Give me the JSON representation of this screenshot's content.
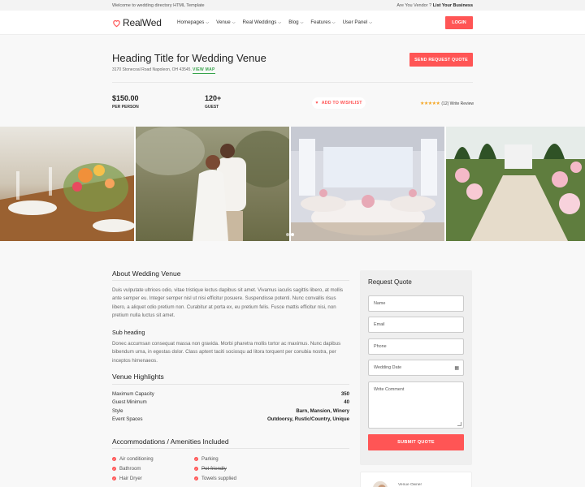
{
  "topbar": {
    "welcome": "Welcome to wedding directory HTML Template",
    "vendor_question": "Are You Vendor ?",
    "list_business": "List Your Business"
  },
  "nav": {
    "logo": "RealWed",
    "menu": [
      "Homepages",
      "Venue",
      "Real Weddings",
      "Blog",
      "Features",
      "User Panel"
    ],
    "login": "LOGIN"
  },
  "venue": {
    "title": "Heading Title for Wedding Venue",
    "address": "3170 Stonecoal Road Napoleon, OH 43545.",
    "view_map": "VIEW MAP",
    "request_quote": "SEND REQUEST QUOTE",
    "price": "$150.00",
    "price_label": "PER PERSON",
    "guests": "120+",
    "guests_label": "GUEST",
    "wishlist": "ADD TO WISHLIST",
    "reviews": "(12) Write Review",
    "rating_stars": 5
  },
  "gallery": {
    "active_slide": 1,
    "slide_count": 2
  },
  "about": {
    "title": "About Wedding Venue",
    "paragraph": "Duis vulputate ultrices odio, vitae tristique lectus dapibus sit amet. Vivamus iaculis sagittis libero, at mollis ante semper eu. Integer semper nisl ut nisi efficitur posuere. Suspendisse potenti. Nunc convallis risus libero, a aliquet odio pretium non. Curabitur at porta ex, eu pretium felis. Fusce mattis efficitur nisi, non pretium nulla luctus sit amet.",
    "subheading": "Sub heading",
    "sub_paragraph": "Donec accumsan consequat massa non gravida. Morbi pharetra mollis tortor ac maximus. Nunc dapibus bibendum urna, in egestas dolor. Class aptent taciti sociosqu ad litora torquent per conubia nostra, per inceptos himenaeos."
  },
  "highlights": {
    "title": "Venue Highlights",
    "rows": [
      {
        "label": "Maximum Capacity",
        "value": "350"
      },
      {
        "label": "Guest Minimum",
        "value": "40"
      },
      {
        "label": "Style",
        "value": "Barn, Mansion, Winery"
      },
      {
        "label": "Event Spaces",
        "value": "Outdoorsy, Rustic/Country, Unique"
      }
    ]
  },
  "amenities": {
    "title": "Accommodations / Amenities Included",
    "items": [
      {
        "label": "Air conditioning",
        "struck": false
      },
      {
        "label": "Parking",
        "struck": false
      },
      {
        "label": "Bathroom",
        "struck": false
      },
      {
        "label": "Pet-friendly",
        "struck": true
      },
      {
        "label": "Hair Dryer",
        "struck": false
      },
      {
        "label": "Towels supplied",
        "struck": false
      }
    ]
  },
  "quote_form": {
    "title": "Request Quote",
    "name_placeholder": "Name",
    "email_placeholder": "Email",
    "phone_placeholder": "Phone",
    "date_placeholder": "Wedding Date",
    "comment_placeholder": "Write Comment",
    "submit": "SUBMIT QUOTE"
  },
  "owner": {
    "label": "Venue Owner"
  },
  "colors": {
    "accent": "#ff5555",
    "map_link": "#36a24a",
    "star": "#f5a623"
  }
}
